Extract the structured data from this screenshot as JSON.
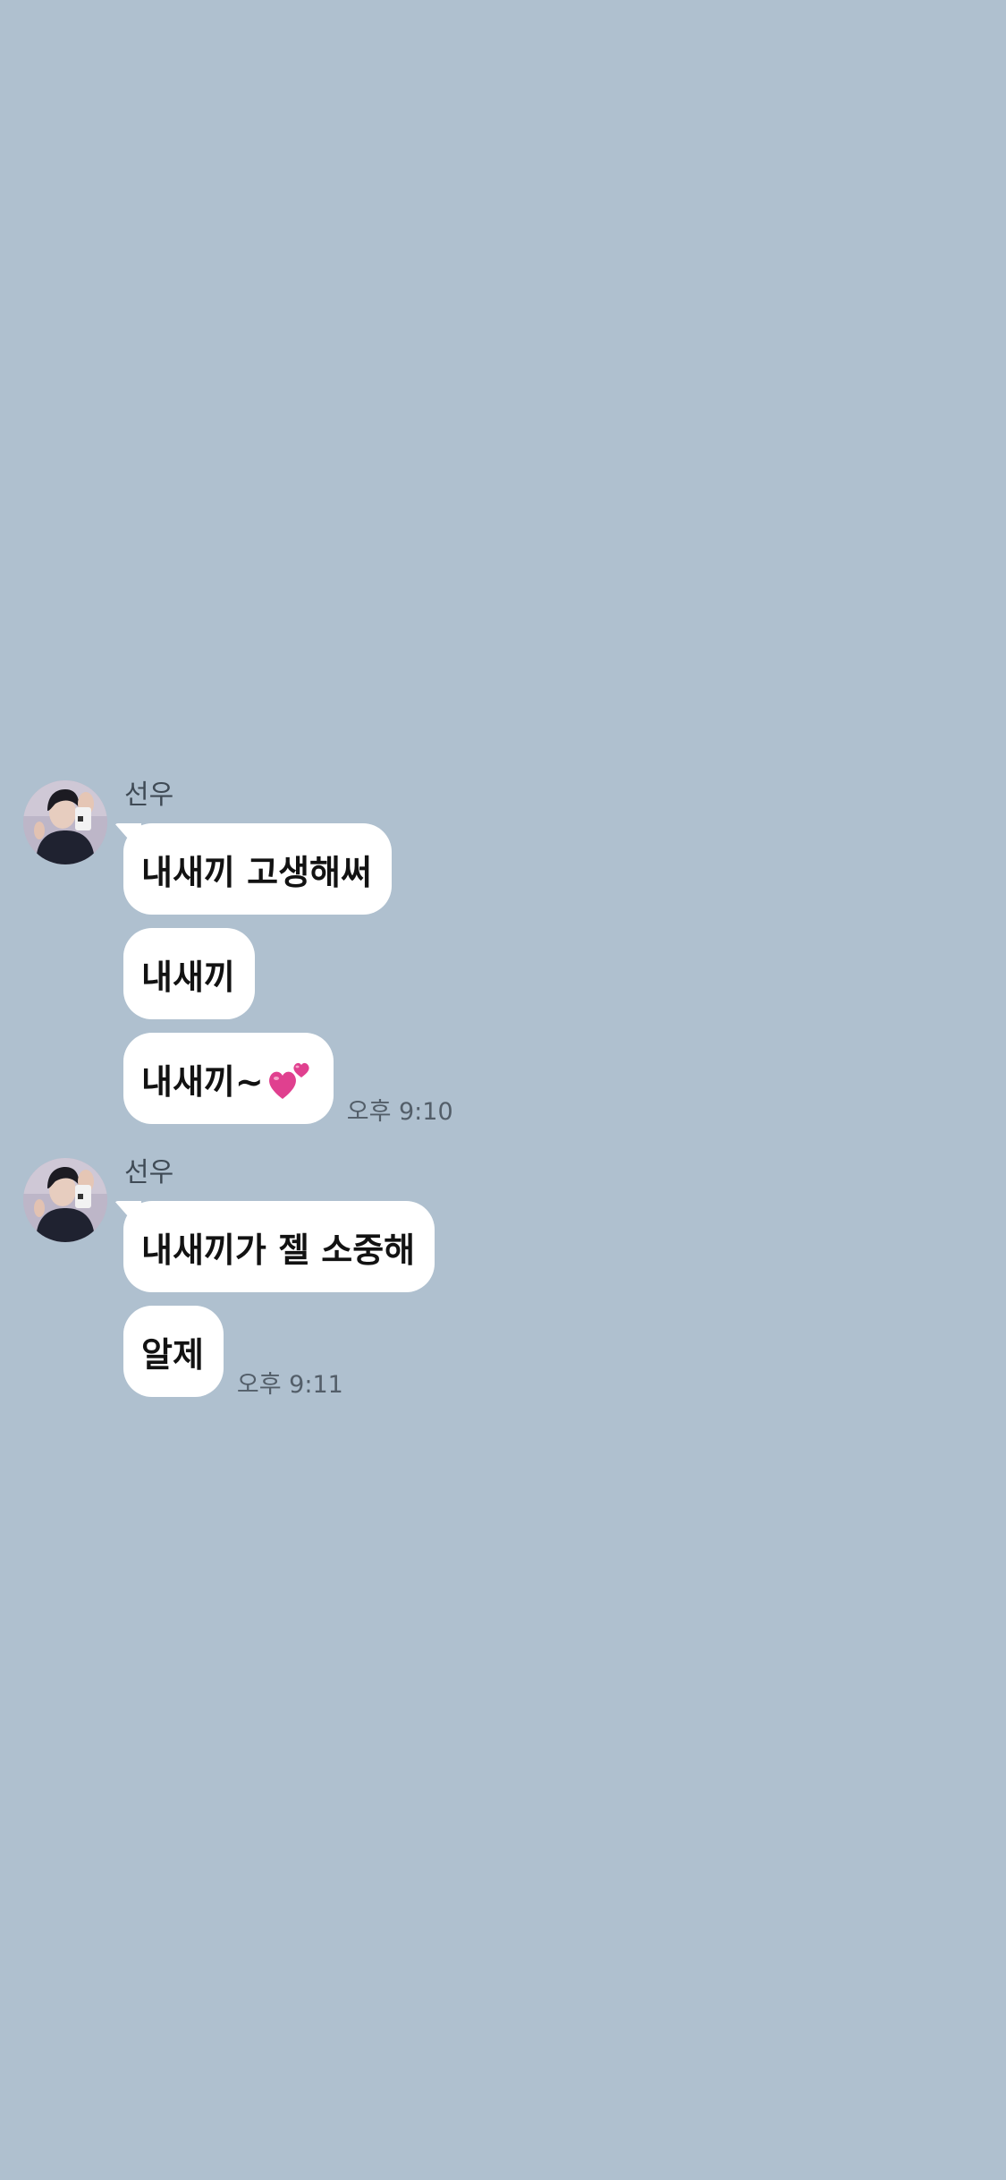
{
  "chat": {
    "groups": [
      {
        "sender": "선우",
        "messages": [
          {
            "text": "내새끼 고생해써"
          },
          {
            "text": "내새끼"
          },
          {
            "text": "내새끼~",
            "emoji": "two-hearts"
          }
        ],
        "time": "오후 9:10"
      },
      {
        "sender": "선우",
        "messages": [
          {
            "text": "내새끼가 젤 소중해"
          },
          {
            "text": "알제"
          }
        ],
        "time": "오후 9:11"
      }
    ]
  },
  "colors": {
    "background": "#afc0cf",
    "bubble": "#ffffff",
    "bubble_text": "#121212",
    "sender_text": "#3f4a55",
    "time_text": "#535e69",
    "heart": "#e0408f"
  }
}
